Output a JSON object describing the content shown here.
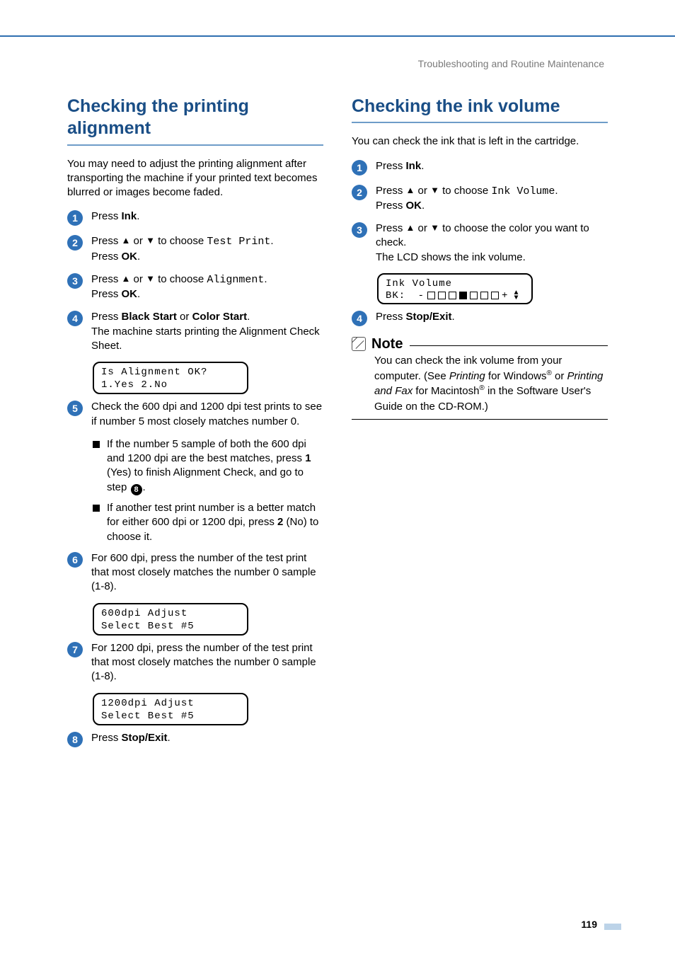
{
  "header": {
    "breadcrumb": "Troubleshooting and Routine Maintenance"
  },
  "page_number": "119",
  "left": {
    "title": "Checking the printing alignment",
    "intro": "You may need to adjust the printing alignment after transporting the machine if your printed text becomes blurred or images become faded.",
    "steps": {
      "s1_a": "Press ",
      "s1_b": "Ink",
      "s1_c": ".",
      "s2_a": "Press ",
      "s2_up": "▲",
      "s2_or": " or ",
      "s2_dn": "▼",
      "s2_b": " to choose ",
      "s2_mono": "Test Print",
      "s2_c": ".",
      "s2_d": "Press ",
      "s2_e": "OK",
      "s2_f": ".",
      "s3_a": "Press ",
      "s3_b": " to choose ",
      "s3_mono": "Alignment",
      "s3_c": ".",
      "s3_d": "Press ",
      "s3_e": "OK",
      "s3_f": ".",
      "s4_a": "Press ",
      "s4_b": "Black Start",
      "s4_c": " or ",
      "s4_d": "Color Start",
      "s4_e": ".",
      "s4_f": "The machine starts printing the Alignment Check Sheet.",
      "lcd4_l1": "Is Alignment OK?",
      "lcd4_l2": "1.Yes 2.No",
      "s5_a": "Check the 600 dpi and 1200 dpi test prints to see if number 5 most closely matches number 0.",
      "s5_li1_a": "If the number 5 sample of both the 600 dpi and 1200 dpi are the best matches, press ",
      "s5_li1_b": "1",
      "s5_li1_c": " (",
      "s5_li1_mono": "Yes",
      "s5_li1_d": ") to finish Alignment Check, and go to step ",
      "s5_li1_ref": "8",
      "s5_li1_e": ".",
      "s5_li2_a": "If another test print number is a better match for either 600 dpi or 1200 dpi, press ",
      "s5_li2_b": "2",
      "s5_li2_c": " (",
      "s5_li2_mono": "No",
      "s5_li2_d": ") to choose it.",
      "s6_a": "For 600 dpi, press the number of the test print that most closely matches the number 0 sample (1-8).",
      "lcd6_l1": "600dpi Adjust",
      "lcd6_l2": "Select Best #5",
      "s7_a": "For 1200 dpi, press the number of the test print that most closely matches the number 0 sample (1-8).",
      "lcd7_l1": "1200dpi Adjust",
      "lcd7_l2": "Select Best #5",
      "s8_a": "Press ",
      "s8_b": "Stop/Exit",
      "s8_c": "."
    }
  },
  "right": {
    "title": "Checking the ink volume",
    "intro": "You can check the ink that is left in the cartridge.",
    "steps": {
      "s1_a": "Press ",
      "s1_b": "Ink",
      "s1_c": ".",
      "s2_a": "Press ",
      "s2_b": " to choose ",
      "s2_mono": "Ink Volume",
      "s2_c": ".",
      "s2_d": "Press ",
      "s2_e": "OK",
      "s2_f": ".",
      "s3_a": "Press ",
      "s3_b": " to choose the color you want to check.",
      "s3_c": "The LCD shows the ink volume.",
      "lcd3_l1": "Ink Volume",
      "lcd3_bk": "BK:",
      "s4_a": "Press ",
      "s4_b": "Stop/Exit",
      "s4_c": "."
    },
    "note": {
      "title": "Note",
      "body_a": "You can check the ink volume from your computer. (See ",
      "body_b": "Printing",
      "body_c": " for Windows",
      "body_d": " or ",
      "body_e": "Printing and Fax",
      "body_f": " for Macintosh",
      "body_g": " in the Software User's Guide on the CD-ROM.)"
    }
  },
  "glyphs": {
    "up": "▲",
    "down": "▼",
    "minus": "-",
    "plus": "+"
  }
}
